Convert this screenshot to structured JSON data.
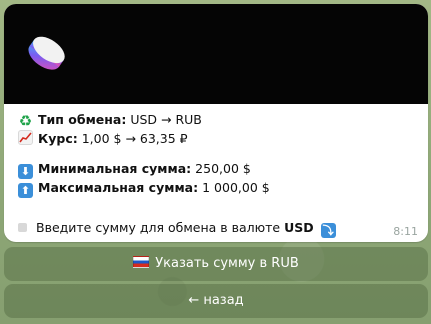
{
  "message": {
    "exchange_type_label": "Тип обмена:",
    "exchange_type_value": "USD → RUB",
    "rate_label": "Курс:",
    "rate_value": "1,00 $ → 63,35 ₽",
    "min_label": "Минимальная сумма:",
    "min_value": "250,00 $",
    "max_label": "Максимальная сумма:",
    "max_value": "1 000,00 $",
    "prompt_text": "Введите сумму для обмена в валюте",
    "prompt_currency": "USD",
    "time": "8:11",
    "icons": {
      "exchange_type": "recycle-icon",
      "rate": "chart-increasing-icon",
      "min": "down-arrow-icon",
      "max": "up-arrow-icon",
      "prompt_end": "down-right-arrow-icon"
    }
  },
  "keyboard": {
    "buttons": [
      {
        "label": "Указать сумму в RUB",
        "icon": "russia-flag-icon"
      },
      {
        "label": "← назад"
      }
    ]
  },
  "colors": {
    "banner_bg": "#050505",
    "bubble_bg": "#ffffff",
    "button_bg": "rgba(70,95,55,0.38)",
    "wallpaper": "#8fa97a"
  }
}
